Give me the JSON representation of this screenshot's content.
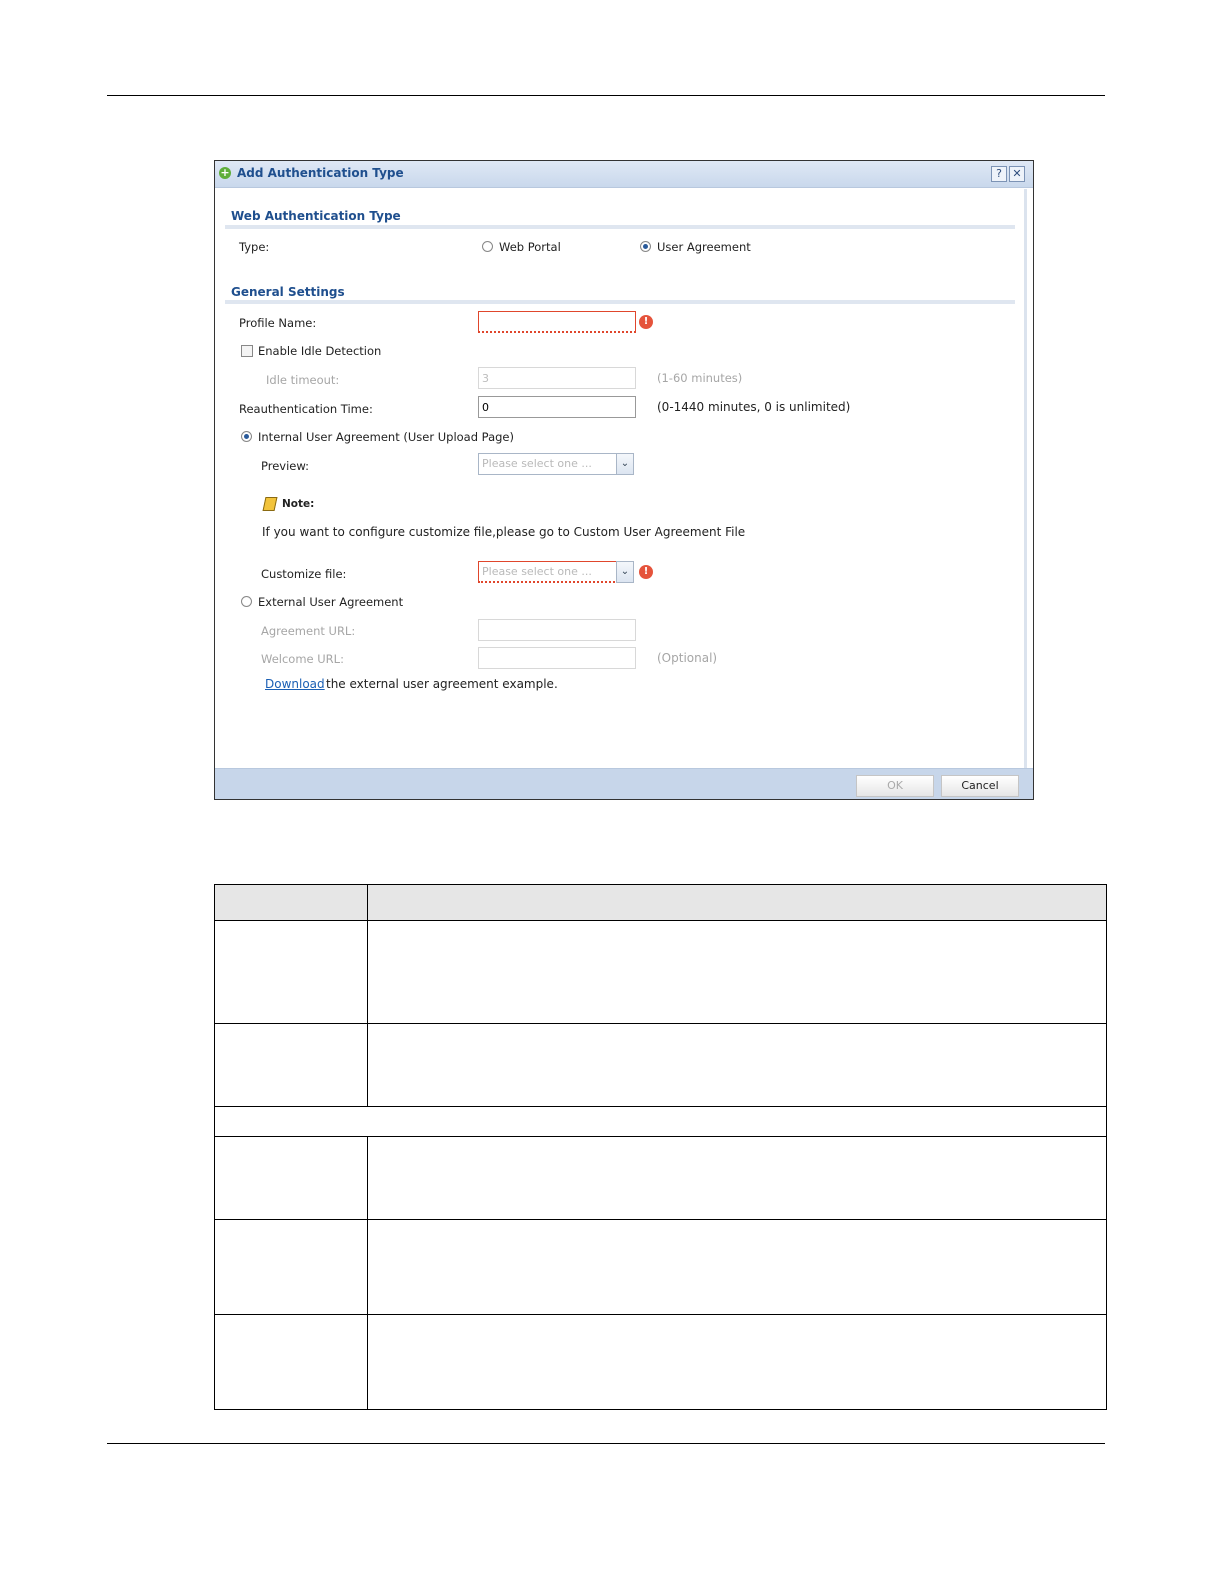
{
  "dialog": {
    "title": "Add Authentication Type",
    "help_label": "?",
    "close_label": "✕",
    "web_auth_section": "Web Authentication Type",
    "type_label": "Type:",
    "type_options": [
      "Web Portal",
      "User Agreement"
    ],
    "selected_type": "User Agreement",
    "general_section": "General Settings",
    "profile_name_label": "Profile Name:",
    "profile_name_value": "",
    "enable_idle_label": "Enable Idle Detection",
    "idle_timeout_label": "Idle timeout:",
    "idle_timeout_value": "3",
    "idle_timeout_hint": "(1-60 minutes)",
    "reauth_label": "Reauthentication Time:",
    "reauth_value": "0",
    "reauth_hint": "(0-1440 minutes, 0 is unlimited)",
    "internal_agreement_label": "Internal User Agreement (User Upload Page)",
    "preview_label": "Preview:",
    "preview_placeholder": "Please select one ...",
    "note_label": "Note:",
    "note_text": "If you want to configure customize file,please go to Custom User Agreement File",
    "customize_label": "Customize file:",
    "customize_placeholder": "Please select one ...",
    "external_agreement_label": "External User Agreement",
    "agreement_url_label": "Agreement URL:",
    "welcome_url_label": "Welcome URL:",
    "optional_hint": "(Optional)",
    "download_link": "Download",
    "download_text": "the external user agreement example.",
    "ok_label": "OK",
    "cancel_label": "Cancel",
    "error_glyph": "!",
    "add_glyph": "+",
    "arrow_glyph": "⌄"
  },
  "colors": {
    "title_text": "#1f4f8e",
    "error": "#e5533b",
    "footer_bg": "#c7d6ea"
  }
}
